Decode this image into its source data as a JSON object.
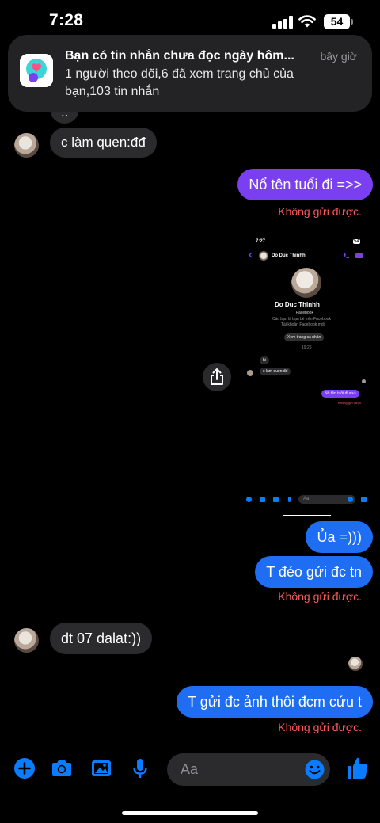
{
  "status_bar": {
    "time": "7:28",
    "battery": "54"
  },
  "notification": {
    "title": "Bạn có tin nhắn chưa đọc ngày hôm...",
    "time": "bây giờ",
    "body": "1 người theo dõi,6 đã xem trang chủ của bạn,103 tin nhắn"
  },
  "messages": {
    "partial_top": "..",
    "in_1": "c làm quen:đđ",
    "out_1": "Nổ tên tuổi đi =>>",
    "fail_label": "Không gửi được.",
    "out_2": "Ủa =)))",
    "out_3": "T đéo gửi đc tn",
    "in_2": "dt 07 dalat:))",
    "out_4": "T gửi đc ảnh thôi đcm cứu t"
  },
  "screenshot": {
    "time": "7:27",
    "battery": "54",
    "contact_name": "Do Duc Thinhh",
    "platform": "Facebook",
    "friends_line": "Các bạn là bạn bè trên Facebook",
    "account_line": "Tài khoản Facebook.mdi",
    "view_profile": "Xem trang cá nhân",
    "timestamp": "19:26",
    "msg_hi": "hi",
    "msg_in": "c làm quen:đđ",
    "msg_out": "Nổ tên tuổi đi =>>",
    "fail": "Không gửi được.",
    "input_placeholder": "Aa"
  },
  "composer": {
    "placeholder": "Aa"
  },
  "colors": {
    "accent": "#0a7cff",
    "purple": "#7b3ff2",
    "blue": "#1f6df2",
    "error": "#ff5a5a"
  }
}
